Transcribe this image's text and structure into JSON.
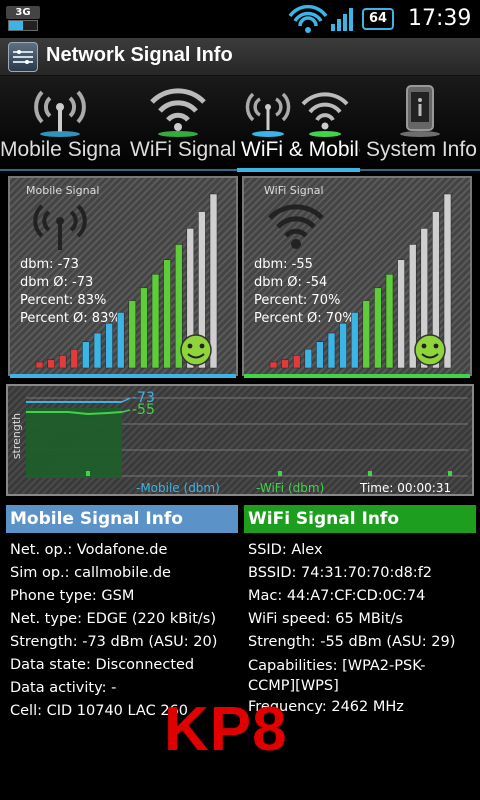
{
  "status_bar": {
    "network_type": "3G",
    "battery_level": "64",
    "time": "17:39",
    "icons": [
      "wifi-icon",
      "signal-icon",
      "battery-icon"
    ]
  },
  "title_bar": {
    "title": "Network Signal Info"
  },
  "tabs": [
    {
      "label": "Mobile Signal",
      "active": false
    },
    {
      "label": "WiFi Signal",
      "active": false
    },
    {
      "label": "WiFi & Mobile",
      "active": true
    },
    {
      "label": "System Info",
      "active": false
    }
  ],
  "mobile_gauge": {
    "title": "Mobile Signal",
    "dbm": "dbm: -73",
    "dbm_avg": "dbm Ø: -73",
    "percent": "Percent: 83%",
    "percent_avg": "Percent Ø: 83%",
    "level": 0.83
  },
  "wifi_gauge": {
    "title": "WiFi Signal",
    "dbm": "dbm: -55",
    "dbm_avg": "dbm Ø: -54",
    "percent": "Percent: 70%",
    "percent_avg": "Percent Ø: 70%",
    "level": 0.7
  },
  "history_graph": {
    "y_label": "strength",
    "mobile_value": "-73",
    "wifi_value": "-55",
    "mobile_legend": "-Mobile (dbm)",
    "wifi_legend": "-WiFi (dbm)",
    "time": "Time: 00:00:31",
    "colors": {
      "mobile": "#3cb4e6",
      "wifi": "#3fd44a"
    }
  },
  "mobile_info": {
    "header": "Mobile Signal Info",
    "header_color": "#5b93c9",
    "rows": [
      "Net. op.: Vodafone.de",
      "Sim op.: callmobile.de",
      "Phone type: GSM",
      "Net. type: EDGE (220 kBit/s)",
      "Strength: -73 dBm (ASU: 20)",
      "Data state: Disconnected",
      "Data activity: -",
      "Cell: CID 10740 LAC 260"
    ]
  },
  "wifi_info": {
    "header": "WiFi Signal Info",
    "header_color": "#1e9e1e",
    "rows": [
      "SSID: Alex",
      "BSSID: 74:31:70:70:d8:f2",
      "Mac: 44:A7:CF:CD:0C:74",
      "WiFi speed: 65 MBit/s",
      "Strength: -55 dBm (ASU: 29)",
      "Capabilities: [WPA2-PSK-",
      "CCMP][WPS]",
      "Frequency: 2462 MHz"
    ]
  },
  "watermark": "KP8"
}
